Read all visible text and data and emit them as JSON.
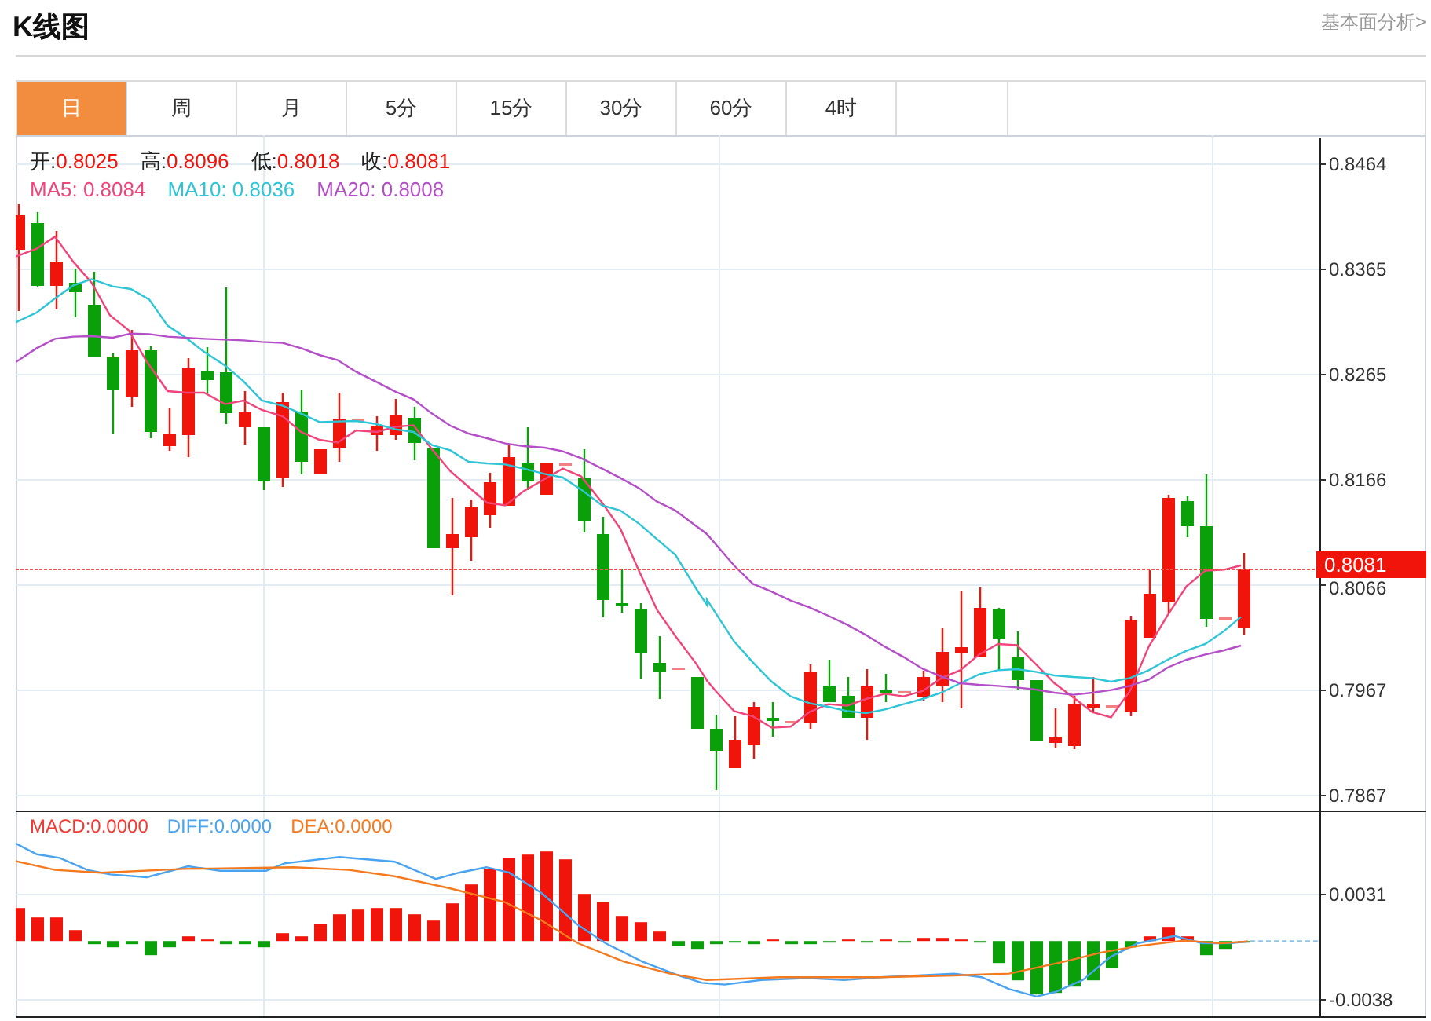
{
  "title": "K线图",
  "link": "基本面分析>",
  "tabs": [
    {
      "label": "日",
      "selected": true
    },
    {
      "label": "周",
      "selected": false
    },
    {
      "label": "月",
      "selected": false
    },
    {
      "label": "5分",
      "selected": false
    },
    {
      "label": "15分",
      "selected": false
    },
    {
      "label": "30分",
      "selected": false
    },
    {
      "label": "60分",
      "selected": false
    },
    {
      "label": "4时",
      "selected": false
    }
  ],
  "quote": [
    {
      "label": "开:",
      "value": "0.8025"
    },
    {
      "label": "高:",
      "value": "0.8096"
    },
    {
      "label": "低:",
      "value": "0.8018"
    },
    {
      "label": "收:",
      "value": "0.8081"
    }
  ],
  "ma_legend": [
    {
      "text": "MA5: 0.8084",
      "color": "#f0447a"
    },
    {
      "text": "MA10: 0.8036",
      "color": "#2ec5d7"
    },
    {
      "text": "MA20: 0.8008",
      "color": "#b44fc8"
    }
  ],
  "price_axis": [
    "0.8464",
    "0.8365",
    "0.8265",
    "0.8166",
    "0.8066",
    "0.7967",
    "0.7867"
  ],
  "current_price": "0.8081",
  "macd_legend": [
    {
      "text": "MACD:0.0000",
      "color": "#f03a32"
    },
    {
      "text": "DIFF:0.0000",
      "color": "#4aa3ef"
    },
    {
      "text": "DEA:0.0000",
      "color": "#f47a20"
    }
  ],
  "macd_axis": [
    "0.0031",
    "-0.0038"
  ]
}
